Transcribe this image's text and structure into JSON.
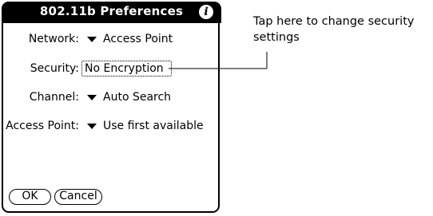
{
  "dialog": {
    "title": "802.11b Preferences",
    "info_icon": "info-icon",
    "fields": {
      "network": {
        "label": "Network:",
        "value": "Access Point"
      },
      "security": {
        "label": "Security:",
        "value": "No Encryption"
      },
      "channel": {
        "label": "Channel:",
        "value": "Auto Search"
      },
      "access_point": {
        "label": "Access Point:",
        "value": "Use first available"
      }
    },
    "buttons": {
      "ok": "OK",
      "cancel": "Cancel"
    }
  },
  "callout": {
    "text": "Tap here to change security settings"
  }
}
